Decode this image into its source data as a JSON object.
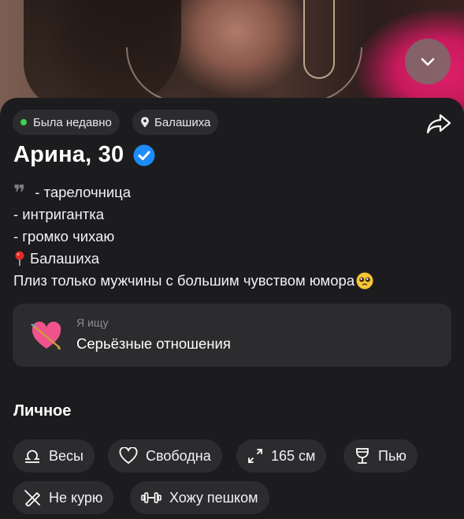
{
  "status": {
    "online_label": "Была недавно",
    "city_label": "Балашиха"
  },
  "profile": {
    "name_age": "Арина, 30",
    "verified": true
  },
  "bio": {
    "lines": [
      "- тарелочница",
      "- интригантка",
      "- громко чихаю",
      "Балашиха",
      "Плиз только мужчины с большим чувством юмора"
    ]
  },
  "looking_for": {
    "label": "Я ищу",
    "value": "Серьёзные отношения"
  },
  "personal": {
    "title": "Личное",
    "tags": [
      {
        "icon": "zodiac-libra-icon",
        "label": "Весы"
      },
      {
        "icon": "heart-icon",
        "label": "Свободна"
      },
      {
        "icon": "height-arrows-icon",
        "label": "165 см"
      },
      {
        "icon": "wine-glass-icon",
        "label": "Пью"
      },
      {
        "icon": "no-smoking-icon",
        "label": "Не курю"
      },
      {
        "icon": "dumbbell-icon",
        "label": "Хожу пешком"
      }
    ]
  },
  "colors": {
    "background": "#1c1c1e",
    "chip": "#2c2c2e",
    "online_dot": "#3ed44e",
    "verified": "#1d8cf8",
    "muted_text": "#8e8e93"
  }
}
